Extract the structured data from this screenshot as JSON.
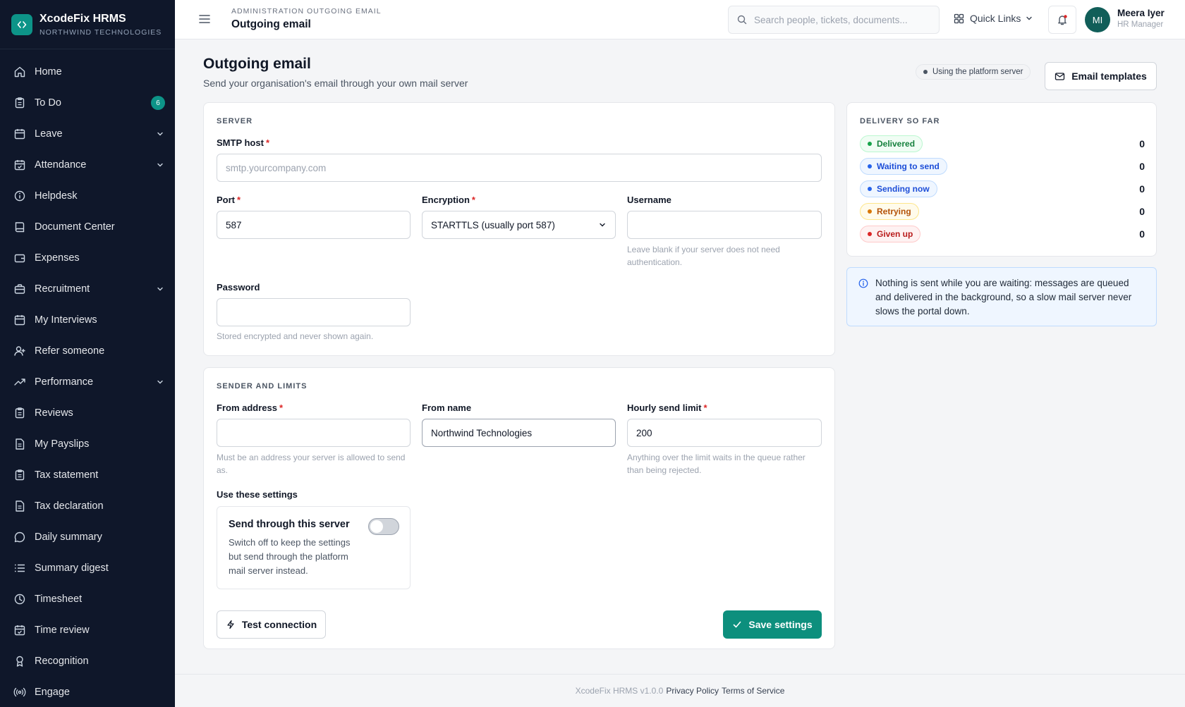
{
  "app": {
    "name": "XcodeFix HRMS",
    "org": "NORTHWIND TECHNOLOGIES"
  },
  "sidebar": {
    "items": [
      {
        "label": "Home",
        "icon": "home-icon"
      },
      {
        "label": "To Do",
        "icon": "clipboard-icon",
        "badge": "6"
      },
      {
        "label": "Leave",
        "icon": "calendar-icon",
        "expandable": true
      },
      {
        "label": "Attendance",
        "icon": "calendar-check-icon",
        "expandable": true
      },
      {
        "label": "Helpdesk",
        "icon": "info-icon"
      },
      {
        "label": "Document Center",
        "icon": "book-icon"
      },
      {
        "label": "Expenses",
        "icon": "wallet-icon"
      },
      {
        "label": "Recruitment",
        "icon": "briefcase-icon",
        "expandable": true
      },
      {
        "label": "My Interviews",
        "icon": "calendar-icon"
      },
      {
        "label": "Refer someone",
        "icon": "user-plus-icon"
      },
      {
        "label": "Performance",
        "icon": "trending-up-icon",
        "expandable": true
      },
      {
        "label": "Reviews",
        "icon": "clipboard-icon"
      },
      {
        "label": "My Payslips",
        "icon": "file-icon"
      },
      {
        "label": "Tax statement",
        "icon": "clipboard-icon"
      },
      {
        "label": "Tax declaration",
        "icon": "file-icon"
      },
      {
        "label": "Daily summary",
        "icon": "chat-icon"
      },
      {
        "label": "Summary digest",
        "icon": "list-icon"
      },
      {
        "label": "Timesheet",
        "icon": "clock-icon"
      },
      {
        "label": "Time review",
        "icon": "calendar-check-icon"
      },
      {
        "label": "Recognition",
        "icon": "award-icon"
      },
      {
        "label": "Engage",
        "icon": "broadcast-icon"
      }
    ]
  },
  "topbar": {
    "breadcrumb": "ADMINISTRATION OUTGOING EMAIL",
    "title": "Outgoing email",
    "search_placeholder": "Search people, tickets, documents...",
    "quick_links": "Quick Links",
    "user_initials": "MI",
    "user_name": "Meera Iyer",
    "user_role": "HR Manager"
  },
  "page": {
    "title": "Outgoing email",
    "subtitle": "Send your organisation's email through your own mail server",
    "status_pill": "Using the platform server",
    "templates_button": "Email templates"
  },
  "server": {
    "section": "SERVER",
    "smtp_host_label": "SMTP host",
    "smtp_host_value": "",
    "smtp_host_placeholder": "smtp.yourcompany.com",
    "port_label": "Port",
    "port_value": "587",
    "encryption_label": "Encryption",
    "encryption_value": "STARTTLS (usually port 587)",
    "username_label": "Username",
    "username_value": "",
    "username_hint": "Leave blank if your server does not need authentication.",
    "password_label": "Password",
    "password_value": "",
    "password_hint": "Stored encrypted and never shown again."
  },
  "sender": {
    "section": "SENDER AND LIMITS",
    "from_address_label": "From address",
    "from_address_value": "",
    "from_address_hint": "Must be an address your server is allowed to send as.",
    "from_name_label": "From name",
    "from_name_value": "Northwind Technologies",
    "hourly_limit_label": "Hourly send limit",
    "hourly_limit_value": "200",
    "hourly_limit_hint": "Anything over the limit waits in the queue rather than being rejected.",
    "use_settings_label": "Use these settings",
    "toggle_title": "Send through this server",
    "toggle_desc": "Switch off to keep the settings but send through the platform mail server instead.",
    "toggle_on": false,
    "test_button": "Test connection",
    "save_button": "Save settings"
  },
  "delivery": {
    "section": "DELIVERY SO FAR",
    "rows": [
      {
        "label": "Delivered",
        "value": "0",
        "color": "#15803d",
        "bg": "#f0fdf4",
        "border": "#bbf7d0",
        "dot": "#16a34a"
      },
      {
        "label": "Waiting to send",
        "value": "0",
        "color": "#1d4ed8",
        "bg": "#eff6ff",
        "border": "#bfdbfe",
        "dot": "#2563eb"
      },
      {
        "label": "Sending now",
        "value": "0",
        "color": "#1d4ed8",
        "bg": "#eff6ff",
        "border": "#bfdbfe",
        "dot": "#2563eb"
      },
      {
        "label": "Retrying",
        "value": "0",
        "color": "#b45309",
        "bg": "#fffbeb",
        "border": "#fde68a",
        "dot": "#d97706"
      },
      {
        "label": "Given up",
        "value": "0",
        "color": "#b91c1c",
        "bg": "#fef2f2",
        "border": "#fecaca",
        "dot": "#dc2626"
      }
    ]
  },
  "info": {
    "text": "Nothing is sent while you are waiting: messages are queued and delivered in the background, so a slow mail server never slows the portal down."
  },
  "footer": {
    "version": "XcodeFix HRMS v1.0.0",
    "privacy": "Privacy Policy",
    "terms": "Terms of Service"
  },
  "colors": {
    "accent": "#0d8f7d",
    "sidebar_bg": "#0f172a"
  }
}
